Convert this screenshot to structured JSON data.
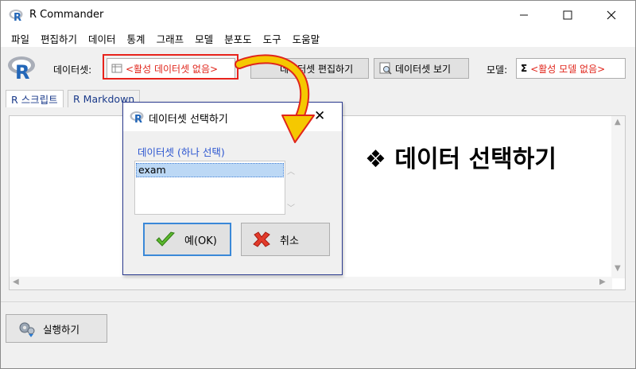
{
  "window": {
    "title": "R Commander"
  },
  "menu": [
    "파일",
    "편집하기",
    "데이터",
    "통계",
    "그래프",
    "모델",
    "분포도",
    "도구",
    "도움말"
  ],
  "toolbar": {
    "dataset_label": "데이터셋:",
    "dataset_value": "<활성 데이터셋 없음>",
    "edit_button": "데이터셋 편집하기",
    "view_button": "데이터셋 보기",
    "model_label": "모델:",
    "model_value": "<활성 모델 없음>"
  },
  "tabs": [
    "R 스크립트",
    "R Markdown"
  ],
  "run_button": "실행하기",
  "dialog": {
    "title": "데이터셋 선택하기",
    "list_label": "데이터셋 (하나 선택)",
    "items": [
      "exam"
    ],
    "ok_label": "예(OK)",
    "cancel_label": "취소"
  },
  "annotation": "❖ 데이터 선택하기",
  "colors": {
    "highlight": "#e8231c",
    "arrow": "#f5c800",
    "selection": "#bcd8f5",
    "label_blue": "#2b55d0"
  }
}
